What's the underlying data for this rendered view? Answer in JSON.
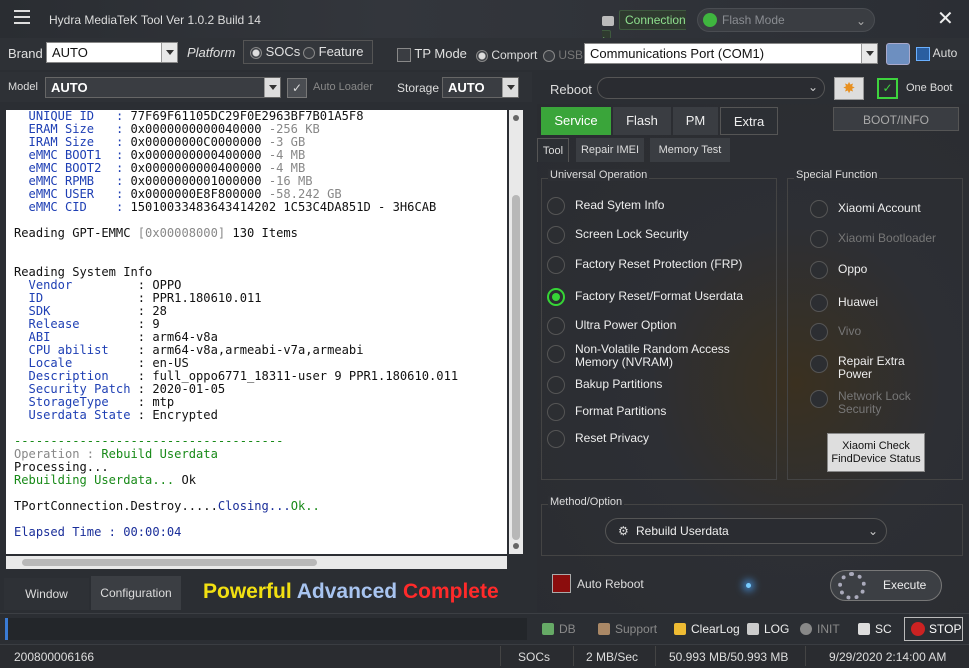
{
  "app": {
    "title": "Hydra MediaTeK Tool  Ver 1.0.2 Build 14"
  },
  "connection": {
    "label": "Connection :",
    "mode": "Flash Mode"
  },
  "brand": {
    "label": "Brand",
    "value": "AUTO"
  },
  "platform": {
    "label": "Platform",
    "socs": "SOCs",
    "feature": "Feature"
  },
  "tp_mode": "TP Mode",
  "port": {
    "comport": "Comport",
    "usb": "USB",
    "value": "Communications Port (COM1)",
    "auto": "Auto"
  },
  "model": {
    "label": "Model",
    "value": "AUTO",
    "auto_loader": "Auto Loader"
  },
  "storage": {
    "label": "Storage",
    "value": "AUTO"
  },
  "reboot": {
    "label": "Reboot",
    "value": "",
    "one_boot": "One Boot"
  },
  "log": {
    "lines": [
      {
        "k": "  UNIQUE ID   ",
        "v": "77F69F61105DC29F0E2963BF7B01A5F8",
        "x": ""
      },
      {
        "k": "  ERAM Size   ",
        "v": "0x0000000000040000",
        "x": " -256 KB"
      },
      {
        "k": "  IRAM Size   ",
        "v": "0x00000000C0000000",
        "x": " -3 GB"
      },
      {
        "k": "  eMMC BOOT1  ",
        "v": "0x0000000000400000",
        "x": " -4 MB"
      },
      {
        "k": "  eMMC BOOT2  ",
        "v": "0x0000000000400000",
        "x": " -4 MB"
      },
      {
        "k": "  eMMC RPMB   ",
        "v": "0x0000000001000000",
        "x": " -16 MB"
      },
      {
        "k": "  eMMC USER   ",
        "v": "0x0000000E8F800000",
        "x": " -58.242 GB"
      },
      {
        "k": "  eMMC CID    ",
        "v": "15010033483643414202 1C53C4DA851D - 3H6CAB",
        "x": ""
      }
    ],
    "gpt": {
      "a": "Reading GPT-EMMC ",
      "b": "[0x00008000]",
      "c": " 130 Items"
    },
    "sys_title": "Reading System Info",
    "sys": [
      {
        "k": "  Vendor         ",
        "v": "OPPO"
      },
      {
        "k": "  ID             ",
        "v": "PPR1.180610.011"
      },
      {
        "k": "  SDK            ",
        "v": "28"
      },
      {
        "k": "  Release        ",
        "v": "9"
      },
      {
        "k": "  ABI            ",
        "v": "arm64-v8a"
      },
      {
        "k": "  CPU abilist    ",
        "v": "arm64-v8a,armeabi-v7a,armeabi"
      },
      {
        "k": "  Locale         ",
        "v": "en-US"
      },
      {
        "k": "  Description    ",
        "v": "full_oppo6771_18311-user 9 PPR1.180610.011"
      },
      {
        "k": "  Security Patch ",
        "v": "2020-01-05"
      },
      {
        "k": "  StorageType    ",
        "v": "mtp"
      },
      {
        "k": "  Userdata State ",
        "v": "Encrypted"
      }
    ],
    "dashes": "-------------------------------------",
    "op_label": "Operation : ",
    "op_value": "Rebuild Userdata",
    "processing": "Processing...",
    "rebuilding": "Rebuilding Userdata... ",
    "ok": "Ok",
    "tport_a": "TPortConnection.Destroy.....",
    "tport_b": "Closing...",
    "tport_c": "Ok..",
    "elapsed": "Elapsed Time : 00:00:04"
  },
  "bottom_tabs": {
    "window": "Window",
    "configuration": "Configuration"
  },
  "slogan": {
    "w1": "Powerful",
    "w2": "Advanced",
    "w3": "Complete",
    "c1": "#f2e012",
    "c2": "#a8c4f0",
    "c3": "#ff2a2a"
  },
  "tabs": {
    "service": "Service",
    "flash": "Flash",
    "pm": "PM",
    "extra": "Extra",
    "boot_info": "BOOT/INFO"
  },
  "subtabs": {
    "tool": "Tool",
    "repair_imei": "Repair IMEI",
    "memory_test": "Memory Test"
  },
  "universal": {
    "title": "Universal Operation",
    "options": [
      "Read Sytem Info",
      "Screen Lock Security",
      "Factory Reset Protection (FRP)",
      "Factory Reset/Format Userdata",
      "Ultra Power Option",
      "Non-Volatile Random Access\nMemory (NVRAM)",
      "Bakup Partitions",
      "Format Partitions",
      "Reset Privacy"
    ]
  },
  "special": {
    "title": "Special Function",
    "options": [
      "Xiaomi Account",
      "Xiaomi Bootloader",
      "Oppo",
      "Huawei",
      "Vivo",
      "Repair Extra\nPower",
      "Network Lock\nSecurity"
    ],
    "xiaomi_check": "Xiaomi Check\nFindDevice Status"
  },
  "method": {
    "title": "Method/Option",
    "value": "Rebuild Userdata"
  },
  "auto_reboot": "Auto Reboot",
  "execute": "Execute",
  "toolbar": {
    "db": "DB",
    "support": "Support",
    "clearlog": "ClearLog",
    "log": "LOG",
    "init": "INIT",
    "sc": "SC",
    "stop": "STOP"
  },
  "status": {
    "serial": "200800006166",
    "socs": "SOCs",
    "speed": "2 MB/Sec",
    "size": "50.993 MB/50.993 MB",
    "datetime": "9/29/2020 2:14:00 AM"
  }
}
